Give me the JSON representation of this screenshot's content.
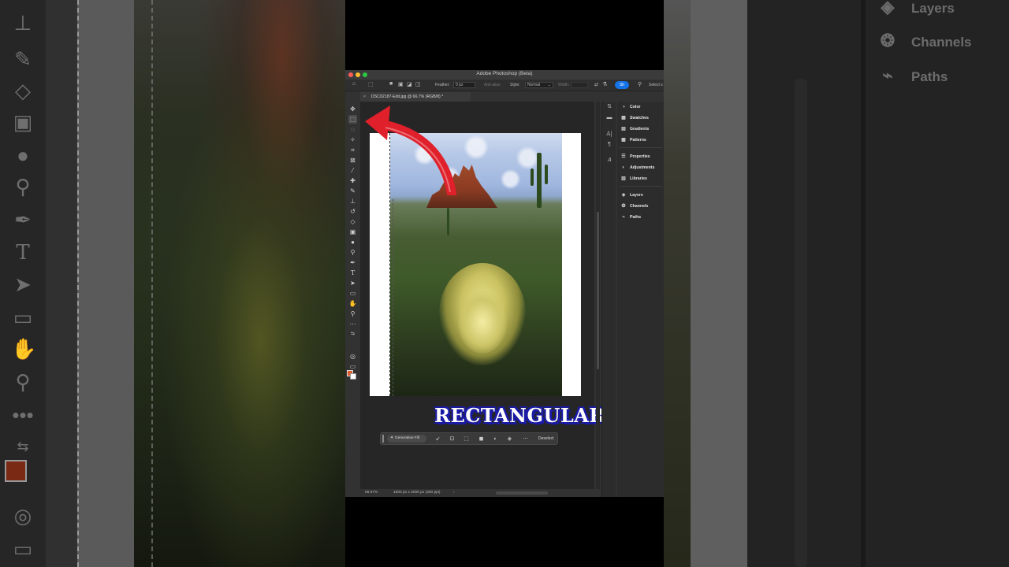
{
  "window": {
    "title": "Adobe Photoshop (Beta)"
  },
  "options_bar": {
    "feather_label": "Feather:",
    "feather_value": "0 px",
    "anti_alias_label": "Anti-alias",
    "style_label": "Style:",
    "style_value": "Normal",
    "width_label": "Width:",
    "share_label": "Sh",
    "select_label": "Select s"
  },
  "document_tab": {
    "label": "DSC02187-Edit.jpg @ 66.7% (RGB/8) *"
  },
  "canvas": {
    "overlay_caption": "RECTANGULAR"
  },
  "contextual_taskbar": {
    "generative_fill_label": "Generative Fill",
    "deselect_label": "Deselect"
  },
  "status_bar": {
    "zoom": "66.67%",
    "doc_info": "1600 px x 2000 px (300 ppi)"
  },
  "panels": [
    {
      "label": "Color",
      "icon": "color-wheel-icon"
    },
    {
      "label": "Swatches",
      "icon": "swatches-grid-icon"
    },
    {
      "label": "Gradients",
      "icon": "gradients-icon"
    },
    {
      "label": "Patterns",
      "icon": "patterns-icon"
    },
    {
      "label": "Properties",
      "icon": "sliders-icon"
    },
    {
      "label": "Adjustments",
      "icon": "adjustments-icon"
    },
    {
      "label": "Libraries",
      "icon": "libraries-icon"
    },
    {
      "label": "Layers",
      "icon": "layers-icon"
    },
    {
      "label": "Channels",
      "icon": "channels-icon"
    },
    {
      "label": "Paths",
      "icon": "paths-icon"
    }
  ],
  "background_panels": [
    {
      "label": "Layers",
      "icon": "layers-icon"
    },
    {
      "label": "Channels",
      "icon": "channels-icon"
    },
    {
      "label": "Paths",
      "icon": "paths-icon"
    }
  ],
  "colors": {
    "foreground": "#e05a2a",
    "background": "#ffffff",
    "caption_outline": "#1a1aa8",
    "arrow": "#e0202a",
    "share_button": "#1473e6"
  }
}
